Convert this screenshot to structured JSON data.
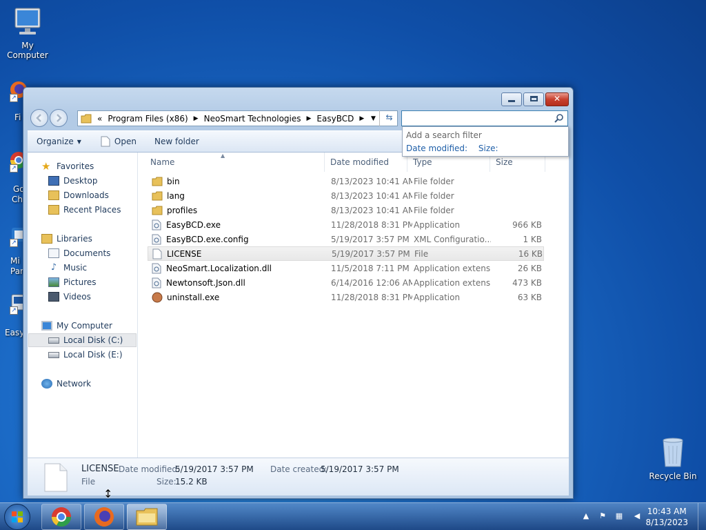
{
  "desktop": {
    "my_computer": "My Computer",
    "recycle_bin": "Recycle Bin",
    "clipped_labels": [
      "Fi",
      "Go",
      "Ch",
      "Mi",
      "Par",
      "Easy"
    ]
  },
  "window": {
    "address": {
      "overflow": "«",
      "segments": [
        "Program Files (x86)",
        "NeoSmart Technologies",
        "EasyBCD"
      ]
    },
    "search": {
      "placeholder": "",
      "filter_title": "Add a search filter",
      "filters": [
        "Date modified:",
        "Size:"
      ]
    },
    "toolbar": {
      "organize": "Organize",
      "open": "Open",
      "new_folder": "New folder"
    },
    "nav": {
      "favorites": "Favorites",
      "desktop": "Desktop",
      "downloads": "Downloads",
      "recent": "Recent Places",
      "libraries": "Libraries",
      "documents": "Documents",
      "music": "Music",
      "pictures": "Pictures",
      "videos": "Videos",
      "computer": "My Computer",
      "disk_c": "Local Disk (C:)",
      "disk_e": "Local Disk (E:)",
      "network": "Network"
    },
    "columns": {
      "name": "Name",
      "date": "Date modified",
      "type": "Type",
      "size": "Size"
    },
    "files": [
      {
        "name": "bin",
        "date": "8/13/2023 10:41 AM",
        "type": "File folder",
        "size": ""
      },
      {
        "name": "lang",
        "date": "8/13/2023 10:41 AM",
        "type": "File folder",
        "size": ""
      },
      {
        "name": "profiles",
        "date": "8/13/2023 10:41 AM",
        "type": "File folder",
        "size": ""
      },
      {
        "name": "EasyBCD.exe",
        "date": "11/28/2018 8:31 PM",
        "type": "Application",
        "size": "966 KB"
      },
      {
        "name": "EasyBCD.exe.config",
        "date": "5/19/2017 3:57 PM",
        "type": "XML Configuratio...",
        "size": "1 KB"
      },
      {
        "name": "LICENSE",
        "date": "5/19/2017 3:57 PM",
        "type": "File",
        "size": "16 KB"
      },
      {
        "name": "NeoSmart.Localization.dll",
        "date": "11/5/2018 7:11 PM",
        "type": "Application extens...",
        "size": "26 KB"
      },
      {
        "name": "Newtonsoft.Json.dll",
        "date": "6/14/2016 12:06 AM",
        "type": "Application extens...",
        "size": "473 KB"
      },
      {
        "name": "uninstall.exe",
        "date": "11/28/2018 8:31 PM",
        "type": "Application",
        "size": "63 KB"
      }
    ],
    "details": {
      "name": "LICENSE",
      "type": "File",
      "modified_label": "Date modified:",
      "modified": "5/19/2017 3:57 PM",
      "created_label": "Date created:",
      "created": "5/19/2017 3:57 PM",
      "size_label": "Size:",
      "size": "15.2 KB"
    }
  },
  "taskbar": {
    "time": "10:43 AM",
    "date": "8/13/2023"
  },
  "colors": {
    "desktop": "#1c6cc8",
    "link": "#1f5fa8",
    "folder": "#e8c15a"
  },
  "icons": [
    "back-icon",
    "forward-icon",
    "folder-icon",
    "refresh-icon",
    "search-icon",
    "star-icon",
    "drive-icon",
    "network-icon",
    "chrome-icon",
    "firefox-icon",
    "explorer-icon",
    "windows-logo-icon"
  ]
}
